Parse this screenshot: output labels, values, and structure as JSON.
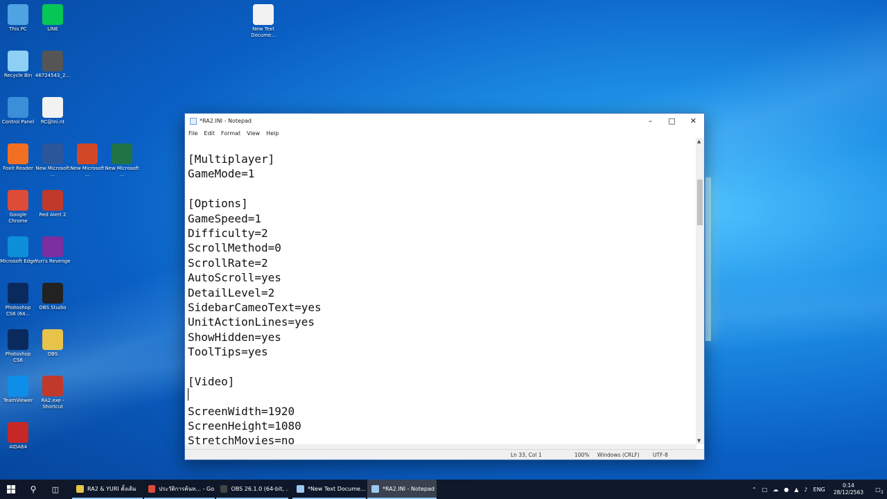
{
  "desktop": {
    "icons": [
      {
        "label": "This PC",
        "icon": "this-pc-icon",
        "color": "#4fa3e3"
      },
      {
        "label": "LINE",
        "icon": "line-icon",
        "color": "#06c755"
      },
      {
        "label": "New Text Docume...",
        "icon": "text-file-icon",
        "color": "#f2f2f2"
      },
      {
        "label": "Recycle Bin",
        "icon": "recycle-bin-icon",
        "color": "#8ecff5"
      },
      {
        "label": "46724543_2...",
        "icon": "photo-icon",
        "color": "#555555"
      },
      {
        "label": "Control Panel",
        "icon": "control-panel-icon",
        "color": "#3a8fd8"
      },
      {
        "label": "RC@Ini.nt",
        "icon": "file-icon",
        "color": "#f2f2f2"
      },
      {
        "label": "Foxit Reader",
        "icon": "foxit-icon",
        "color": "#f36f21"
      },
      {
        "label": "New Microsoft ...",
        "icon": "word-icon",
        "color": "#2b579a"
      },
      {
        "label": "New Microsoft ...",
        "icon": "powerpoint-icon",
        "color": "#d24726"
      },
      {
        "label": "New Microsoft ...",
        "icon": "excel-icon",
        "color": "#217346"
      },
      {
        "label": "Google Chrome",
        "icon": "chrome-icon",
        "color": "#dd4b39"
      },
      {
        "label": "Red Alert 2",
        "icon": "red-alert-icon",
        "color": "#c0392b"
      },
      {
        "label": "Microsoft Edge",
        "icon": "edge-icon",
        "color": "#0c8fd8"
      },
      {
        "label": "Yuri's Revenge",
        "icon": "yuri-icon",
        "color": "#7b2fa0"
      },
      {
        "label": "Photoshop CS6 (64...",
        "icon": "photoshop-icon",
        "color": "#0a2a5e"
      },
      {
        "label": "OBS Studio",
        "icon": "obs-icon",
        "color": "#222222"
      },
      {
        "label": "Photoshop CS6",
        "icon": "photoshop-icon",
        "color": "#0a2a5e"
      },
      {
        "label": "OBS",
        "icon": "folder-icon",
        "color": "#e8c34a"
      },
      {
        "label": "TeamViewer",
        "icon": "teamviewer-icon",
        "color": "#0e8ee9"
      },
      {
        "label": "RA2.exe - Shortcut",
        "icon": "red-alert-icon",
        "color": "#c0392b"
      },
      {
        "label": "AIDA64",
        "icon": "aida64-icon",
        "color": "#c62828"
      }
    ]
  },
  "notepad": {
    "title": "*RA2.INI - Notepad",
    "menu": [
      "File",
      "Edit",
      "Format",
      "View",
      "Help"
    ],
    "lines": [
      "[Multiplayer]",
      "GameMode=1",
      "",
      "[Options]",
      "GameSpeed=1",
      "Difficulty=2",
      "ScrollMethod=0",
      "ScrollRate=2",
      "AutoScroll=yes",
      "DetailLevel=2",
      "SidebarCameoText=yes",
      "UnitActionLines=yes",
      "ShowHidden=yes",
      "ToolTips=yes",
      "",
      "[Video]",
      "",
      "ScreenWidth=1920",
      "ScreenHeight=1080",
      "StretchMovies=no"
    ],
    "status": {
      "position": "Ln 33, Col 1",
      "zoom": "100%",
      "line_ending": "Windows (CRLF)",
      "encoding": "UTF-8"
    }
  },
  "taskbar": {
    "apps": [
      {
        "label": "RA2 & YURI ตั้งเดิม",
        "icon": "folder-icon",
        "color": "#e8c34a",
        "state": "open"
      },
      {
        "label": "ประวัติการค้นห... - Go...",
        "icon": "chrome-icon",
        "color": "#dd4b39",
        "state": "open"
      },
      {
        "label": "OBS 26.1.0 (64-bit, ...",
        "icon": "obs-icon",
        "color": "#444444",
        "state": "open"
      },
      {
        "label": "*New Text Docume...",
        "icon": "notepad-icon",
        "color": "#9ec8ef",
        "state": "open"
      },
      {
        "label": "*RA2.INI - Notepad",
        "icon": "notepad-icon",
        "color": "#9ec8ef",
        "state": "active"
      }
    ],
    "language": "ENG",
    "time": "0:14",
    "date": "28/12/2563",
    "notification_count": "2"
  }
}
